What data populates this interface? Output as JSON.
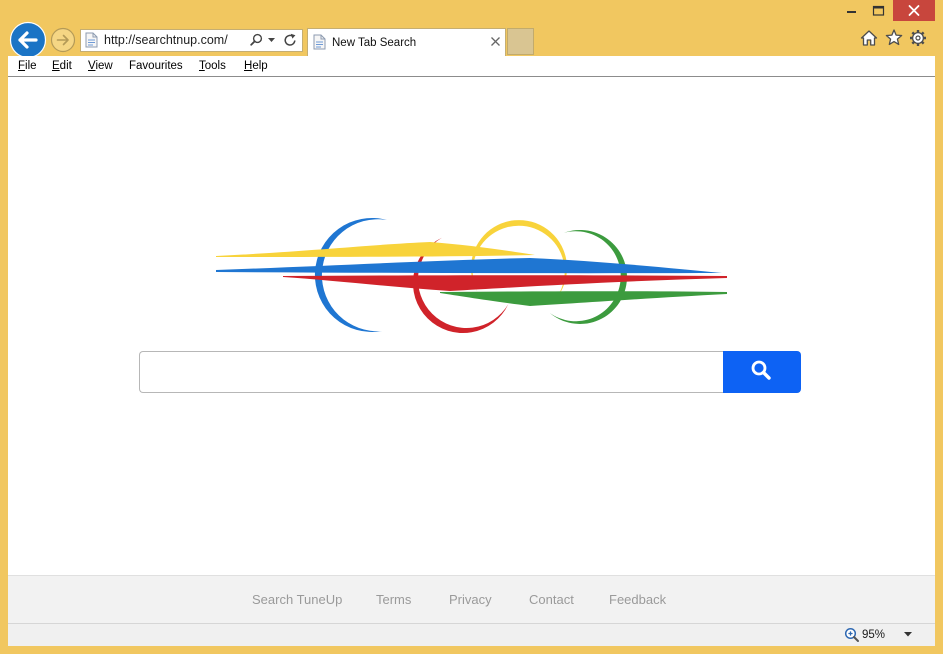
{
  "window": {
    "minimize_icon": "minimize-icon",
    "maximize_icon": "maximize-icon",
    "close_icon": "close-icon",
    "close_color": "#c8463d",
    "frame_color": "#f1c760"
  },
  "navigation": {
    "back_icon": "back-arrow-icon",
    "forward_icon": "forward-arrow-icon",
    "address": "http://searchtnup.com/",
    "site_icon": "page-icon",
    "search_icon": "search-icon",
    "dropdown_icon": "chevron-down-icon",
    "refresh_icon": "refresh-icon"
  },
  "tabs": [
    {
      "title": "New Tab Search",
      "icon": "page-icon",
      "close_icon": "close-icon"
    }
  ],
  "toolbar": {
    "home_icon": "home-icon",
    "favorites_icon": "star-icon",
    "tools_icon": "gear-icon"
  },
  "menu": [
    {
      "label": "File"
    },
    {
      "label": "Edit"
    },
    {
      "label": "View"
    },
    {
      "label": "Favourites"
    },
    {
      "label": "Tools"
    },
    {
      "label": "Help"
    }
  ],
  "page": {
    "logo_colors": {
      "blue": "#1f76d2",
      "red": "#d0232a",
      "yellow": "#f8d33b",
      "green": "#3c9b3e"
    },
    "search": {
      "query": "",
      "button_icon": "search-icon",
      "button_color": "#0d62f4"
    },
    "footer_links": [
      "Search TuneUp",
      "Terms",
      "Privacy",
      "Contact",
      "Feedback"
    ]
  },
  "status_bar": {
    "zoom": "95%",
    "zoom_icon": "zoom-icon",
    "dropdown_icon": "chevron-down-icon"
  }
}
